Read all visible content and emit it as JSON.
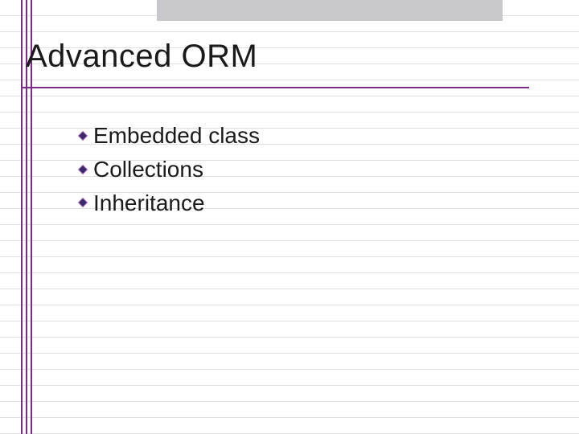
{
  "slide": {
    "title": "Advanced ORM",
    "bullets": [
      {
        "text": "Embedded class"
      },
      {
        "text": "Collections"
      },
      {
        "text": "Inheritance"
      }
    ]
  },
  "colors": {
    "accent": "#7a2b8a",
    "topbar": "#c8c8cc"
  }
}
